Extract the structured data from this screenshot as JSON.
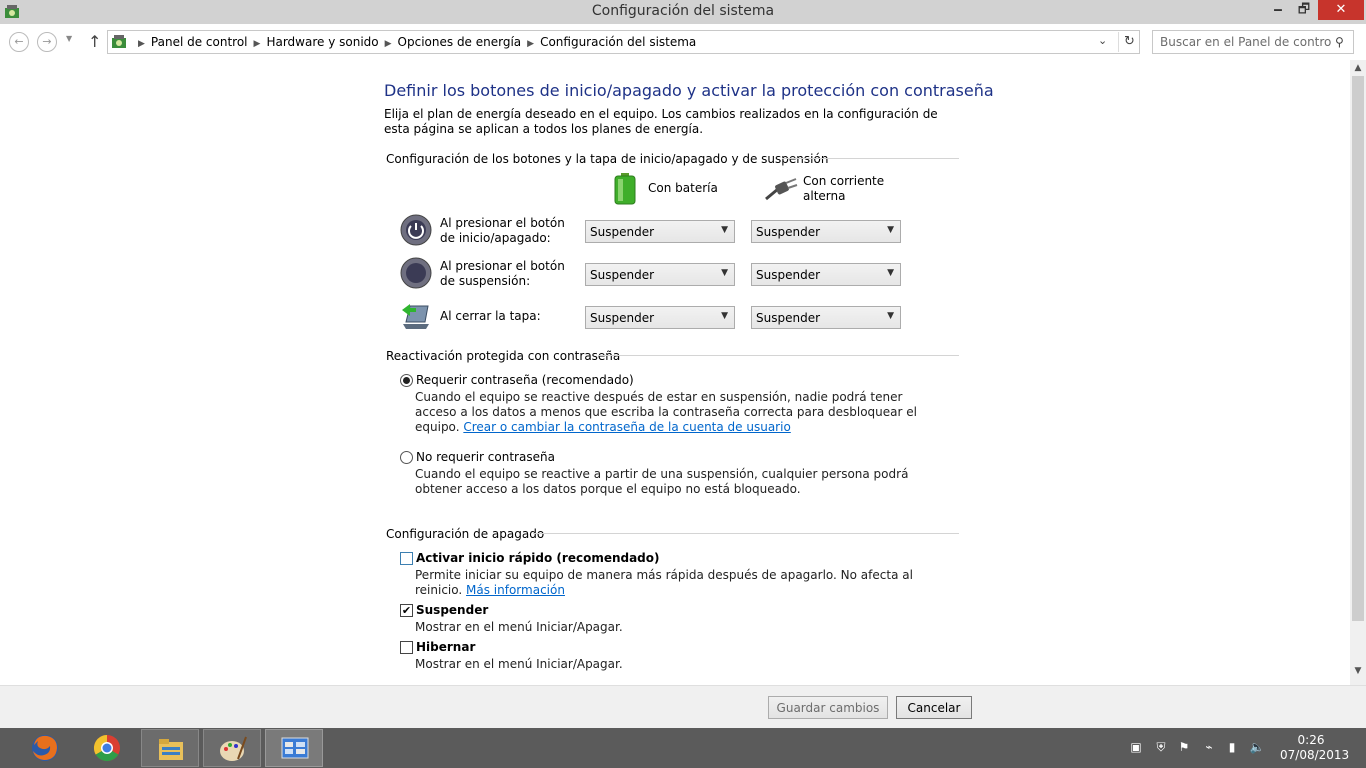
{
  "window": {
    "title": "Configuración del sistema",
    "minimize": "🗕",
    "restore": "🗗",
    "close": "✕"
  },
  "nav": {
    "back_icon": "←",
    "forward_icon": "→",
    "up_icon": "↑",
    "breadcrumbs": [
      "Panel de control",
      "Hardware y sonido",
      "Opciones de energía",
      "Configuración del sistema"
    ],
    "search_placeholder": "Buscar en el Panel de control"
  },
  "page": {
    "title": "Definir los botones de inicio/apagado y activar la protección con contraseña",
    "intro": "Elija el plan de energía deseado en el equipo. Los cambios realizados en la configuración de esta página se aplican a todos los planes de energía."
  },
  "power_buttons": {
    "section_title": "Configuración de los botones y la tapa de inicio/apagado y de suspensión",
    "col_battery": "Con batería",
    "col_ac": "Con corriente alterna",
    "rows": [
      {
        "label": "Al presionar el botón de inicio/apagado:",
        "battery": "Suspender",
        "ac": "Suspender"
      },
      {
        "label": "Al presionar el botón de suspensión:",
        "battery": "Suspender",
        "ac": "Suspender"
      },
      {
        "label": "Al cerrar la tapa:",
        "battery": "Suspender",
        "ac": "Suspender"
      }
    ]
  },
  "password": {
    "section_title": "Reactivación protegida con contraseña",
    "require_label": "Requerir contraseña (recomendado)",
    "require_desc": "Cuando el equipo se reactive después de estar en suspensión, nadie podrá tener acceso a los datos a menos que escriba la contraseña correcta para desbloquear el equipo.",
    "require_link": "Crear o cambiar la contraseña de la cuenta de usuario",
    "no_require_label": "No requerir contraseña",
    "no_require_desc": "Cuando el equipo se reactive a partir de una suspensión, cualquier persona podrá obtener acceso a los datos porque el equipo no está bloqueado.",
    "selected": "require"
  },
  "shutdown": {
    "section_title": "Configuración de apagado",
    "fast_label": "Activar inicio rápido (recomendado)",
    "fast_desc": "Permite iniciar su equipo de manera más rápida después de apagarlo. No afecta al reinicio.",
    "fast_link": "Más información",
    "fast_checked": false,
    "sleep_label": "Suspender",
    "sleep_desc": "Mostrar en el menú Iniciar/Apagar.",
    "sleep_checked": true,
    "hibernate_label": "Hibernar",
    "hibernate_desc": "Mostrar en el menú Iniciar/Apagar.",
    "hibernate_checked": false
  },
  "footer": {
    "save_label": "Guardar cambios",
    "cancel_label": "Cancelar"
  },
  "taskbar": {
    "apps": [
      "firefox-icon",
      "chrome-icon",
      "file-explorer-icon",
      "paint-icon",
      "control-panel-icon"
    ],
    "time": "0:26",
    "date": "07/08/2013"
  }
}
